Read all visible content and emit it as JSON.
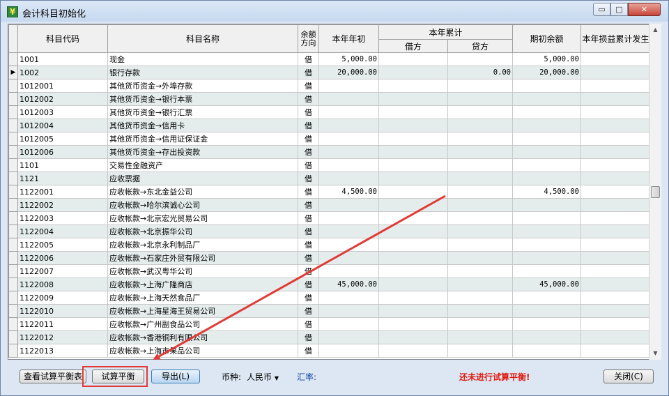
{
  "window": {
    "title": "会计科目初始化"
  },
  "title_controls": {
    "minimize": "▭",
    "maximize": "□",
    "close": "✕"
  },
  "table": {
    "headers": {
      "code": "科目代码",
      "name": "科目名称",
      "direction_line1": "余额",
      "direction_line2": "方向",
      "year_begin": "本年年初",
      "year_total": "本年累计",
      "debit": "借方",
      "credit": "贷方",
      "opening": "期初余额",
      "pl_total": "本年损益累计发生"
    },
    "current_row_marker": "▶",
    "rows": [
      {
        "code": "1001",
        "name": "现金",
        "dir": "借",
        "begin": "5,000.00",
        "debit": "",
        "credit": "",
        "opening": "5,000.00",
        "pl": ""
      },
      {
        "code": "1002",
        "name": "银行存款",
        "dir": "借",
        "begin": "20,000.00",
        "debit": "",
        "credit": "0.00",
        "opening": "20,000.00",
        "pl": "",
        "current": true
      },
      {
        "code": "1012001",
        "name": "其他货币资金→外埠存款",
        "dir": "借",
        "begin": "",
        "debit": "",
        "credit": "",
        "opening": "",
        "pl": ""
      },
      {
        "code": "1012002",
        "name": "其他货币资金→银行本票",
        "dir": "借",
        "begin": "",
        "debit": "",
        "credit": "",
        "opening": "",
        "pl": ""
      },
      {
        "code": "1012003",
        "name": "其他货币资金→银行汇票",
        "dir": "借",
        "begin": "",
        "debit": "",
        "credit": "",
        "opening": "",
        "pl": ""
      },
      {
        "code": "1012004",
        "name": "其他货币资金→信用卡",
        "dir": "借",
        "begin": "",
        "debit": "",
        "credit": "",
        "opening": "",
        "pl": ""
      },
      {
        "code": "1012005",
        "name": "其他货币资金→信用证保证金",
        "dir": "借",
        "begin": "",
        "debit": "",
        "credit": "",
        "opening": "",
        "pl": ""
      },
      {
        "code": "1012006",
        "name": "其他货币资金→存出投资款",
        "dir": "借",
        "begin": "",
        "debit": "",
        "credit": "",
        "opening": "",
        "pl": ""
      },
      {
        "code": "1101",
        "name": "交易性金融资产",
        "dir": "借",
        "begin": "",
        "debit": "",
        "credit": "",
        "opening": "",
        "pl": ""
      },
      {
        "code": "1121",
        "name": "应收票据",
        "dir": "借",
        "begin": "",
        "debit": "",
        "credit": "",
        "opening": "",
        "pl": ""
      },
      {
        "code": "1122001",
        "name": "应收帐款→东北金益公司",
        "dir": "借",
        "begin": "4,500.00",
        "debit": "",
        "credit": "",
        "opening": "4,500.00",
        "pl": ""
      },
      {
        "code": "1122002",
        "name": "应收帐款→哈尔滨诚心公司",
        "dir": "借",
        "begin": "",
        "debit": "",
        "credit": "",
        "opening": "",
        "pl": ""
      },
      {
        "code": "1122003",
        "name": "应收帐款→北京宏光贸易公司",
        "dir": "借",
        "begin": "",
        "debit": "",
        "credit": "",
        "opening": "",
        "pl": ""
      },
      {
        "code": "1122004",
        "name": "应收帐款→北京振华公司",
        "dir": "借",
        "begin": "",
        "debit": "",
        "credit": "",
        "opening": "",
        "pl": ""
      },
      {
        "code": "1122005",
        "name": "应收帐款→北京永利制品厂",
        "dir": "借",
        "begin": "",
        "debit": "",
        "credit": "",
        "opening": "",
        "pl": ""
      },
      {
        "code": "1122006",
        "name": "应收帐款→石家庄外贸有限公司",
        "dir": "借",
        "begin": "",
        "debit": "",
        "credit": "",
        "opening": "",
        "pl": ""
      },
      {
        "code": "1122007",
        "name": "应收帐款→武汉粤华公司",
        "dir": "借",
        "begin": "",
        "debit": "",
        "credit": "",
        "opening": "",
        "pl": ""
      },
      {
        "code": "1122008",
        "name": "应收帐款→上海广隆商店",
        "dir": "借",
        "begin": "45,000.00",
        "debit": "",
        "credit": "",
        "opening": "45,000.00",
        "pl": ""
      },
      {
        "code": "1122009",
        "name": "应收帐款→上海天然食品厂",
        "dir": "借",
        "begin": "",
        "debit": "",
        "credit": "",
        "opening": "",
        "pl": ""
      },
      {
        "code": "1122010",
        "name": "应收帐款→上海星海王贸易公司",
        "dir": "借",
        "begin": "",
        "debit": "",
        "credit": "",
        "opening": "",
        "pl": ""
      },
      {
        "code": "1122011",
        "name": "应收帐款→广州副食品公司",
        "dir": "借",
        "begin": "",
        "debit": "",
        "credit": "",
        "opening": "",
        "pl": ""
      },
      {
        "code": "1122012",
        "name": "应收帐款→香港铜利有限公司",
        "dir": "借",
        "begin": "",
        "debit": "",
        "credit": "",
        "opening": "",
        "pl": ""
      },
      {
        "code": "1122013",
        "name": "应收帐款→上海市果品公司",
        "dir": "借",
        "begin": "",
        "debit": "",
        "credit": "",
        "opening": "",
        "pl": ""
      }
    ]
  },
  "scrollbar": {
    "up_arrow": "▲",
    "down_arrow": "▼"
  },
  "footer": {
    "view_trial_balance": "查看试算平衡表",
    "trial_balance": "试算平衡",
    "export": "导出(L)",
    "currency_label": "币种:",
    "currency_value": "人民币",
    "currency_arrow": "▼",
    "rate_label": "汇率:",
    "status": "还未进行试算平衡!",
    "close": "关闭(C)"
  },
  "colors": {
    "status_red": "#e01b10",
    "rate_blue": "#0a3fa8",
    "highlight_red": "#e03b36",
    "alt_row": "#e4edec"
  }
}
